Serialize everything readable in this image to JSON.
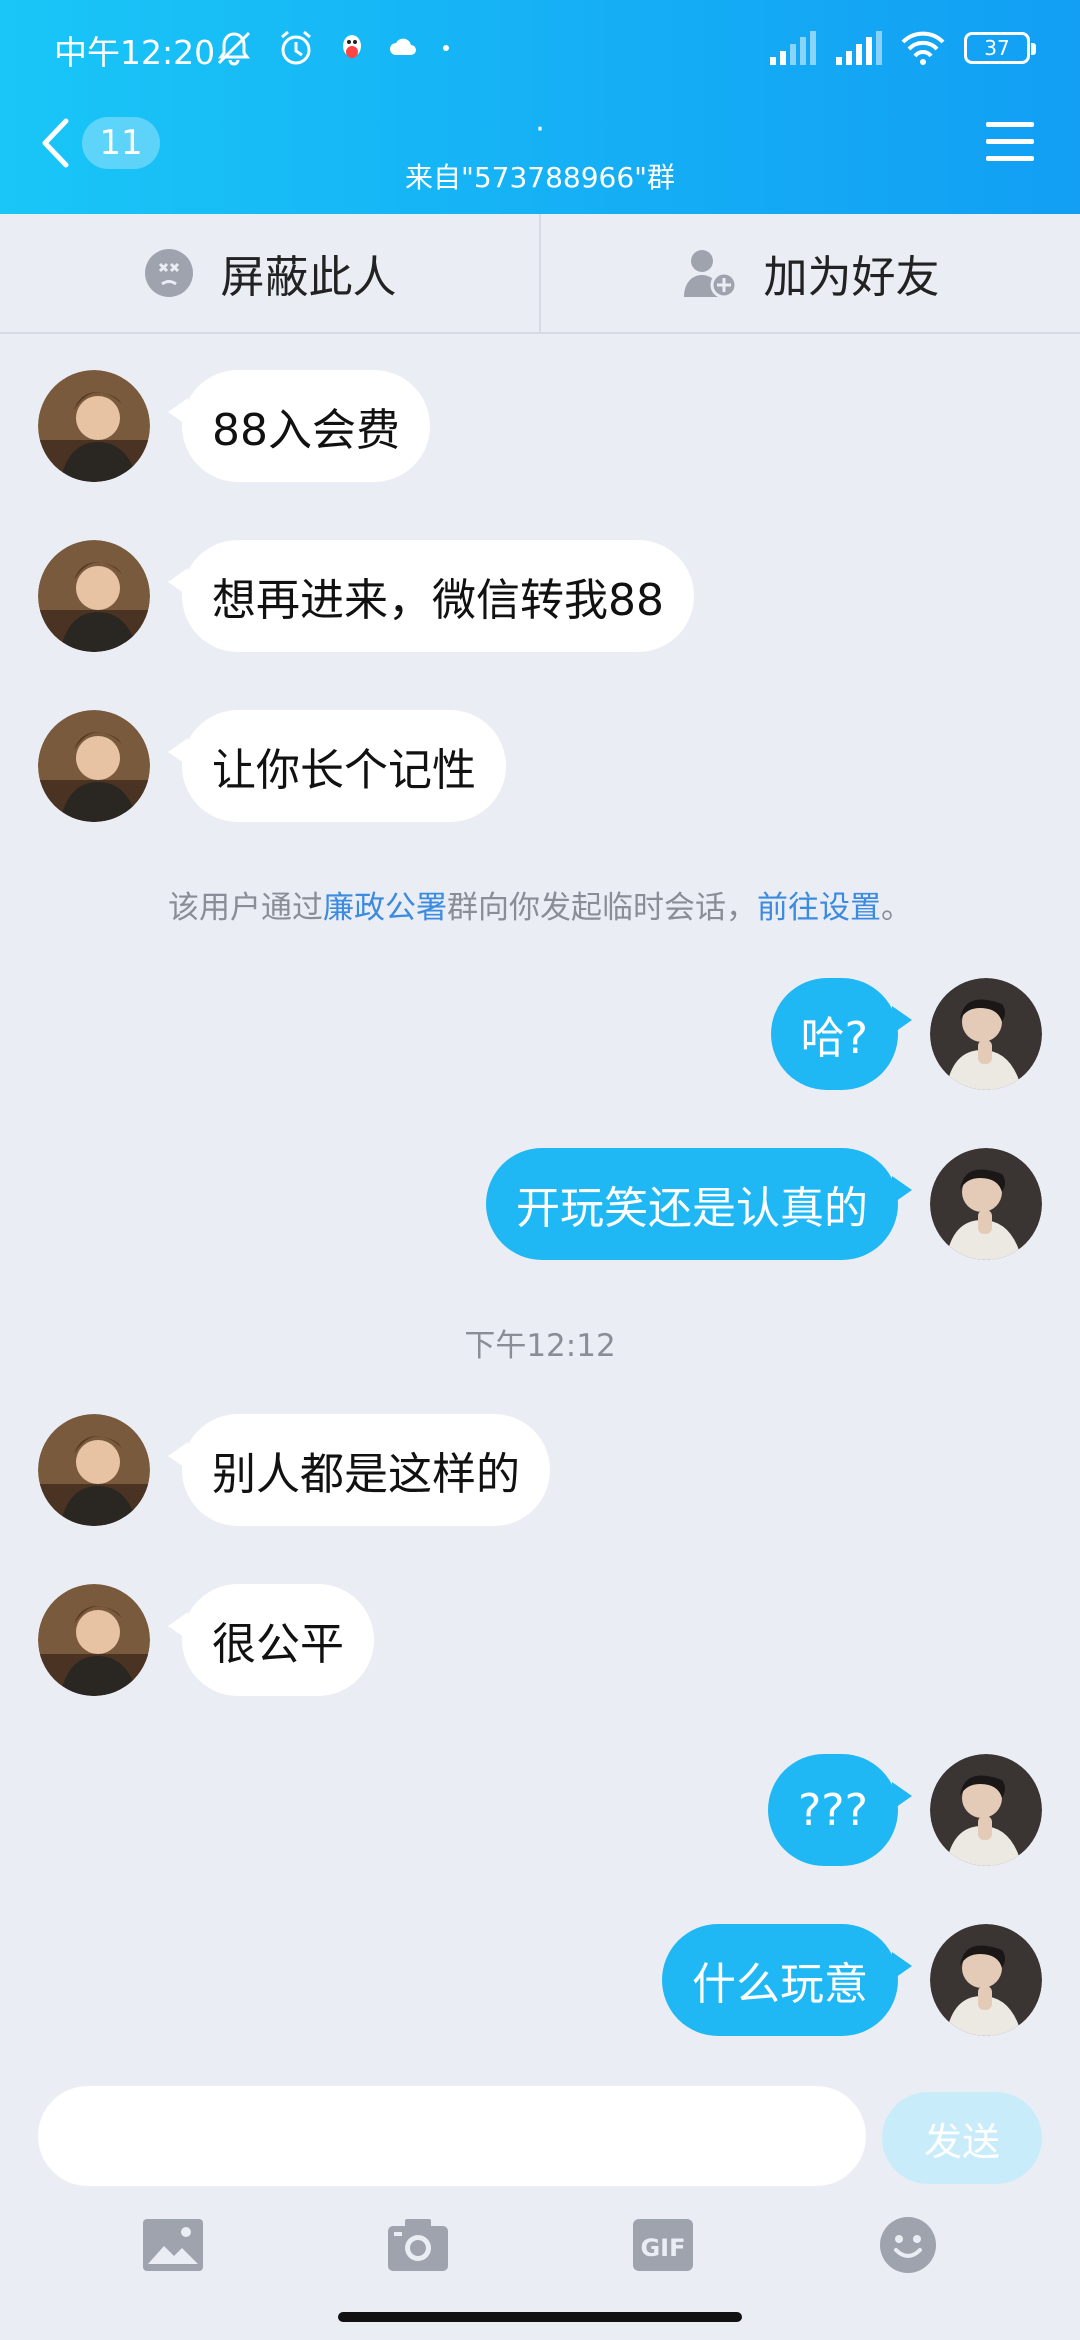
{
  "status_bar": {
    "time": "中午12:20",
    "battery": "37"
  },
  "header": {
    "unread_count": "11",
    "title": "·",
    "subtitle": "来自\"573788966\"群"
  },
  "actions": {
    "block_label": "屏蔽此人",
    "add_friend_label": "加为好友"
  },
  "messages": [
    {
      "text": "88入会费"
    },
    {
      "text": "想再进来，微信转我88"
    },
    {
      "text": "让你长个记性"
    },
    {
      "text": "哈?"
    },
    {
      "text": "开玩笑还是认真的"
    },
    {
      "text": "别人都是这样的"
    },
    {
      "text": "很公平"
    },
    {
      "text": "???"
    },
    {
      "text": "什么玩意"
    }
  ],
  "system_note": {
    "prefix": "该用户通过",
    "group_link": "廉政公署",
    "middle": "群向你发起临时会话，",
    "settings_link": "前往设置",
    "suffix": "。"
  },
  "time_separator": "下午12:12",
  "composer": {
    "placeholder": "",
    "send_label": "发送"
  },
  "toolbar": {
    "gif_label": "GIF"
  },
  "colors": {
    "header_gradient_start": "#19c6f7",
    "header_gradient_end": "#129ff4",
    "outgoing_bubble": "#1fb8f4",
    "incoming_bubble": "#ffffff",
    "chat_background": "#ebedf5",
    "link": "#3b8be0"
  }
}
